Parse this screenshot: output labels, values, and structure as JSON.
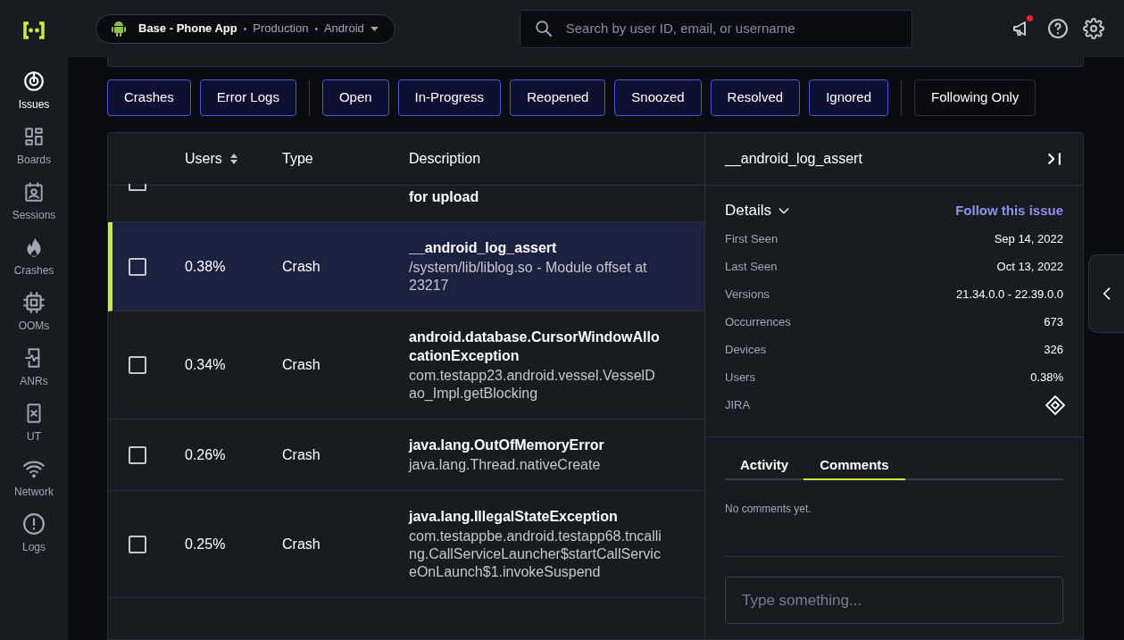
{
  "sidebar": {
    "items": [
      {
        "kind": "issues",
        "label": "Issues",
        "selected": true
      },
      {
        "kind": "boards",
        "label": "Boards",
        "selected": false
      },
      {
        "kind": "sessions",
        "label": "Sessions",
        "selected": false
      },
      {
        "kind": "crashes",
        "label": "Crashes",
        "selected": false
      },
      {
        "kind": "ooms",
        "label": "OOMs",
        "selected": false
      },
      {
        "kind": "anrs",
        "label": "ANRs",
        "selected": false
      },
      {
        "kind": "ut",
        "label": "UT",
        "selected": false
      },
      {
        "kind": "network",
        "label": "Network",
        "selected": false
      },
      {
        "kind": "logs",
        "label": "Logs",
        "selected": false
      }
    ]
  },
  "app_selector": {
    "app": "Base - Phone App",
    "separator_1": "•",
    "environment": "Production",
    "separator_2": "•",
    "platform": "Android"
  },
  "search": {
    "placeholder": "Search by user ID, email, or username"
  },
  "notifications": {
    "unread": true
  },
  "filter_groups": [
    [
      {
        "label": "Crashes",
        "selected": true
      },
      {
        "label": "Error Logs",
        "selected": true
      }
    ],
    [
      {
        "label": "Open",
        "selected": true
      },
      {
        "label": "In-Progress",
        "selected": true
      },
      {
        "label": "Reopened",
        "selected": true
      },
      {
        "label": "Snoozed",
        "selected": true
      },
      {
        "label": "Resolved",
        "selected": true
      },
      {
        "label": "Ignored",
        "selected": true
      }
    ],
    [
      {
        "label": "Following Only",
        "selected": false
      }
    ]
  ],
  "table": {
    "columns": [
      "Users",
      "Type",
      "Description"
    ],
    "rows": [
      {
        "selected": false,
        "title": "for upload"
      },
      {
        "checked": false,
        "selected": true,
        "users": "0.38%",
        "type": "Crash",
        "title": "__android_log_assert",
        "detail": "/system/lib/liblog.so - Module offset at 23217"
      },
      {
        "checked": false,
        "selected": false,
        "users": "0.34%",
        "type": "Crash",
        "title": "android.database.CursorWindowAllocationException",
        "detail": "com.testapp23.android.vessel.VesselDao_Impl.getBlocking"
      },
      {
        "checked": false,
        "selected": false,
        "users": "0.26%",
        "type": "Crash",
        "title": "java.lang.OutOfMemoryError",
        "detail": "java.lang.Thread.nativeCreate"
      },
      {
        "checked": false,
        "selected": false,
        "users": "0.25%",
        "type": "Crash",
        "title": "java.lang.IllegalStateException",
        "detail": "com.testappbe.android.testapp68.tncalling.CallServiceLauncher$startCallServiceOnLaunch$1.invokeSuspend"
      }
    ]
  },
  "detail_panel": {
    "title": "__android_log_assert",
    "section": "Details",
    "expanded": true,
    "follow_link": "Follow this issue",
    "fields": [
      {
        "kind": "text",
        "label": "First Seen",
        "value": "Sep 14, 2022"
      },
      {
        "kind": "text",
        "label": "Last Seen",
        "value": "Oct 13, 2022"
      },
      {
        "kind": "text",
        "label": "Versions",
        "value": "21.34.0.0 - 22.39.0.0"
      },
      {
        "kind": "text",
        "label": "Occurrences",
        "value": "673"
      },
      {
        "kind": "text",
        "label": "Devices",
        "value": "326"
      },
      {
        "kind": "text",
        "label": "Users",
        "value": "0.38%"
      },
      {
        "kind": "jira",
        "label": "JIRA"
      }
    ],
    "tabs": [
      {
        "label": "Activity",
        "selected": false
      },
      {
        "label": "Comments",
        "selected": true
      }
    ],
    "empty_message": "No comments yet.",
    "comment_input": {
      "placeholder": "Type something..."
    }
  }
}
